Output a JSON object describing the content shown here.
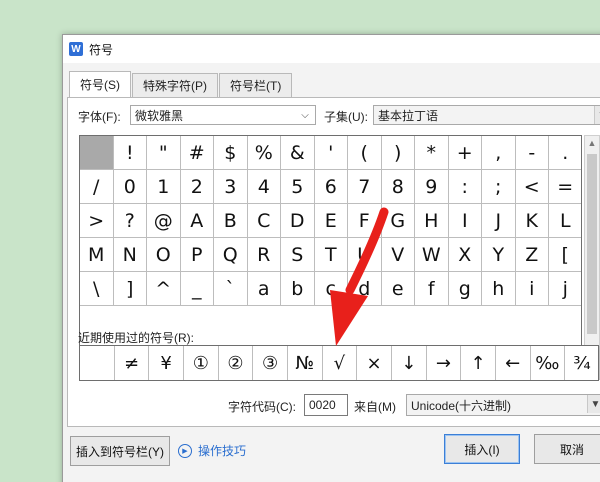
{
  "dialog": {
    "title": "符号",
    "app_icon_letter": "W"
  },
  "tabs": [
    {
      "label": "符号(S)",
      "active": true
    },
    {
      "label": "特殊字符(P)",
      "active": false
    },
    {
      "label": "符号栏(T)",
      "active": false
    }
  ],
  "font": {
    "label": "字体(F):",
    "value": "微软雅黑"
  },
  "subset": {
    "label": "子集(U):",
    "value": "基本拉丁语"
  },
  "symbols": [
    [
      " ",
      "!",
      "\"",
      "#",
      "$",
      "%",
      "&",
      "'",
      "(",
      ")",
      "*",
      "+",
      ",",
      "-",
      "."
    ],
    [
      "/",
      "0",
      "1",
      "2",
      "3",
      "4",
      "5",
      "6",
      "7",
      "8",
      "9",
      ":",
      ";",
      "<",
      "="
    ],
    [
      ">",
      "?",
      "@",
      "A",
      "B",
      "C",
      "D",
      "E",
      "F",
      "G",
      "H",
      "I",
      "J",
      "K",
      "L"
    ],
    [
      "M",
      "N",
      "O",
      "P",
      "Q",
      "R",
      "S",
      "T",
      "U",
      "V",
      "W",
      "X",
      "Y",
      "Z",
      "["
    ],
    [
      "\\",
      "]",
      "^",
      "_",
      "`",
      "a",
      "b",
      "c",
      "d",
      "e",
      "f",
      "g",
      "h",
      "i",
      "j"
    ]
  ],
  "recent": {
    "label": "近期使用过的符号(R):",
    "symbols": [
      "",
      "≠",
      "¥",
      "①",
      "②",
      "③",
      "№",
      "√",
      "×",
      "↓",
      "→",
      "↑",
      "←",
      "‰",
      "¾"
    ]
  },
  "char_code": {
    "label": "字符代码(C):",
    "value": "0020"
  },
  "from": {
    "label": "来自(M)",
    "value": "Unicode(十六进制)"
  },
  "buttons": {
    "insert_to_bar": "插入到符号栏(Y)",
    "tips": "操作技巧",
    "insert": "插入(I)",
    "cancel": "取消"
  },
  "colors": {
    "accent": "#2a6ecf",
    "annotation_arrow": "#e8201b",
    "app_icon": "#2f6fd6"
  }
}
